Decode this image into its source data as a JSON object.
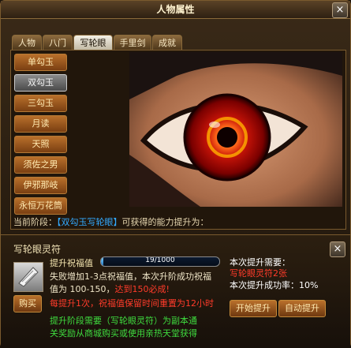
{
  "window": {
    "title": "人物属性",
    "close_label": "×"
  },
  "tabs": [
    {
      "label": "人物"
    },
    {
      "label": "八门"
    },
    {
      "label": "写轮眼",
      "active": true
    },
    {
      "label": "手里剑"
    },
    {
      "label": "成就"
    }
  ],
  "sidebar": {
    "items": [
      {
        "label": "单勾玉"
      },
      {
        "label": "双勾玉",
        "selected": true
      },
      {
        "label": "三勾玉"
      },
      {
        "label": "月读"
      },
      {
        "label": "天照"
      },
      {
        "label": "须佐之男"
      },
      {
        "label": "伊邪那岐"
      },
      {
        "label": "永恒万花筒"
      }
    ]
  },
  "stage": {
    "prefix": "当前阶段：",
    "current": "【双勾玉写轮眼】",
    "suffix": "可获得的能力提升为："
  },
  "upgrade": {
    "item_name": "写轮眼灵符",
    "blessing_label": "提升祝福值",
    "blessing_current": 19,
    "blessing_max": 1000,
    "blessing_text": "19/1000",
    "desc_line1": "失败增加1-3点祝福值，本次升阶成功祝福",
    "desc_line2_prefix": "值为 100-150，",
    "desc_line2_red": "达到150必成!",
    "warning": "每提升1次，祝福值保留时间重置为12小时",
    "tip_line1": "提升阶段需要（写轮眼灵符）为副本通",
    "tip_line2": "关奖励从商城购买或使用亲热天堂获得",
    "buy_label": "购买",
    "need_label": "本次提升需要：",
    "need_item": "写轮眼灵符2张",
    "success_label": "本次提升成功率：",
    "success_rate": "10%",
    "start_label": "开始提升",
    "auto_label": "自动提升",
    "close_label": "×"
  },
  "colors": {
    "accent": "#c48a3a",
    "red_text": "#ff3b2a",
    "green_text": "#3fdc3f",
    "blue_text": "#33aaff"
  }
}
